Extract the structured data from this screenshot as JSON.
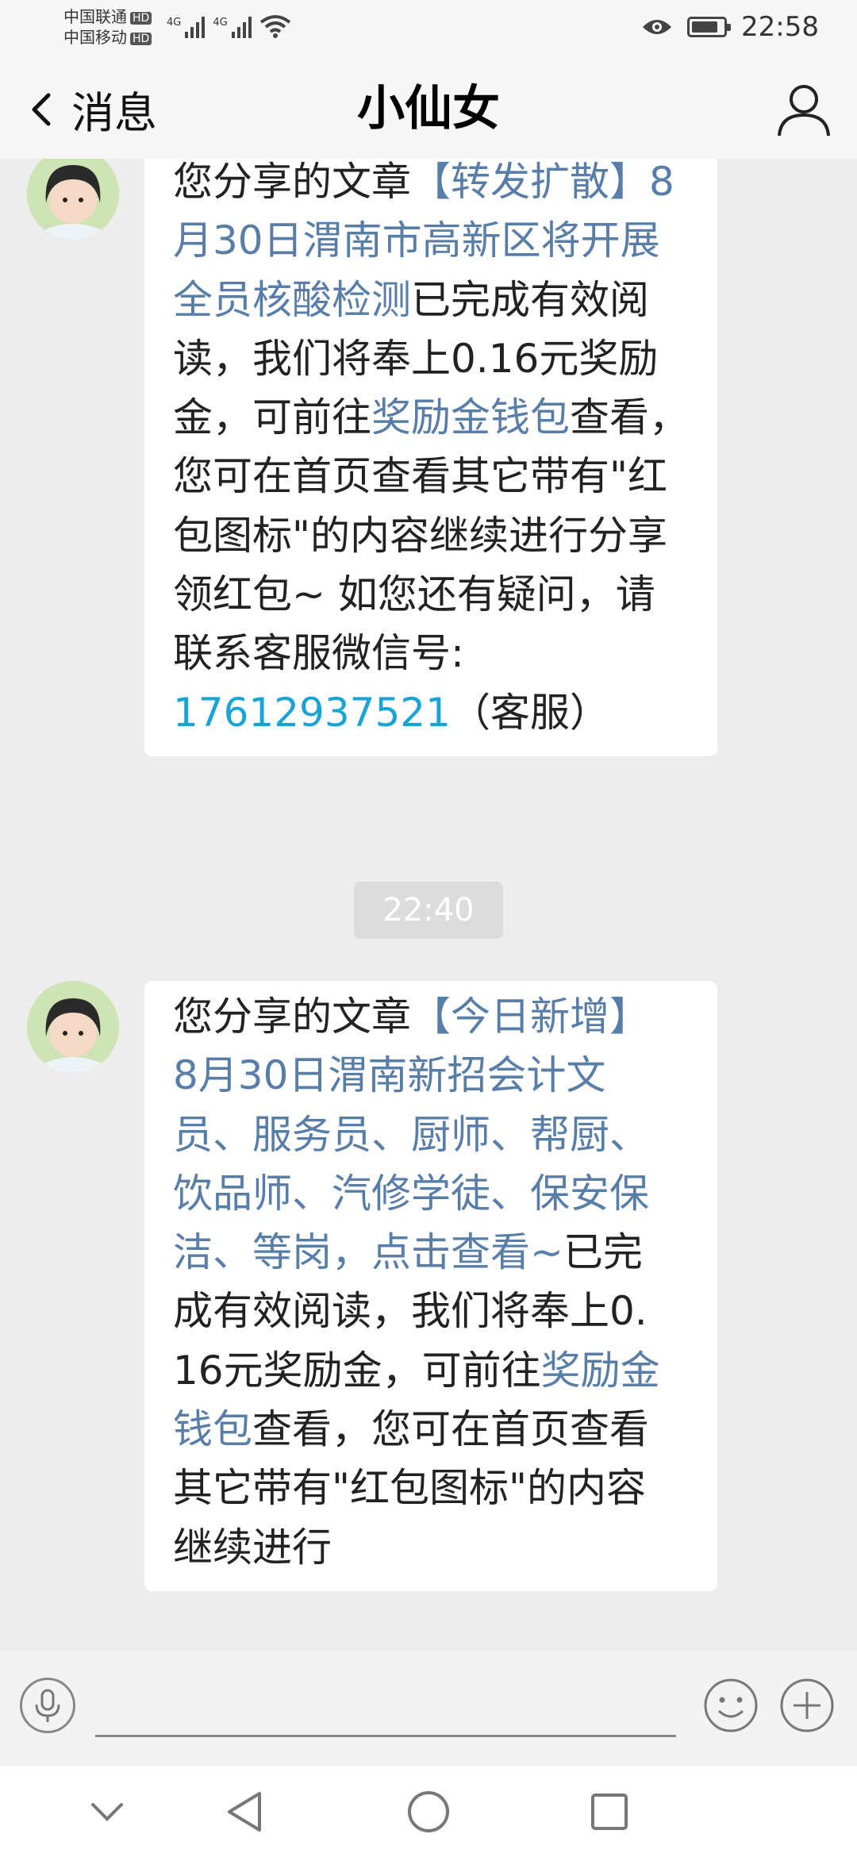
{
  "status_bar": {
    "carrier_1": "中国联通",
    "carrier_2": "中国移动",
    "hd_badge": "HD",
    "network_1": "4G",
    "network_2": "4G",
    "time": "22:58",
    "battery_level": 0.85
  },
  "header": {
    "back_label": "消息",
    "title": "小仙女"
  },
  "messages": [
    {
      "p1": "您分享的文章",
      "link1": "【转发扩散】8月30日渭南市高新区将开展全员核酸检测",
      "p2": "已完成有效阅读，我们将奉上0.16元奖励金，可前往",
      "link2": "奖励金钱包",
      "p3": "查看，您可在首页查看其它带有\"红包图标\"的内容继续进行分享领红包~ 如您还有疑问，请联系客服微信号:",
      "phone": "17612937521",
      "p4": "（客服）"
    },
    {
      "p1": "您分享的文章",
      "link1": "【今日新增】8月30日渭南新招会计文员、服务员、厨师、帮厨、饮品师、汽修学徒、保安保洁、等岗，点击查看~",
      "p2": "已完成有效阅读，我们将奉上0.16元奖励金，可前往",
      "link2": "奖励金钱包",
      "p3": "查看，您可在首页查看其它带有\"红包图标\"的内容继续进行"
    }
  ],
  "time_separator": "22:40",
  "colors": {
    "link": "#587ea8",
    "phone": "#1aa4d6",
    "background": "#ededed"
  }
}
